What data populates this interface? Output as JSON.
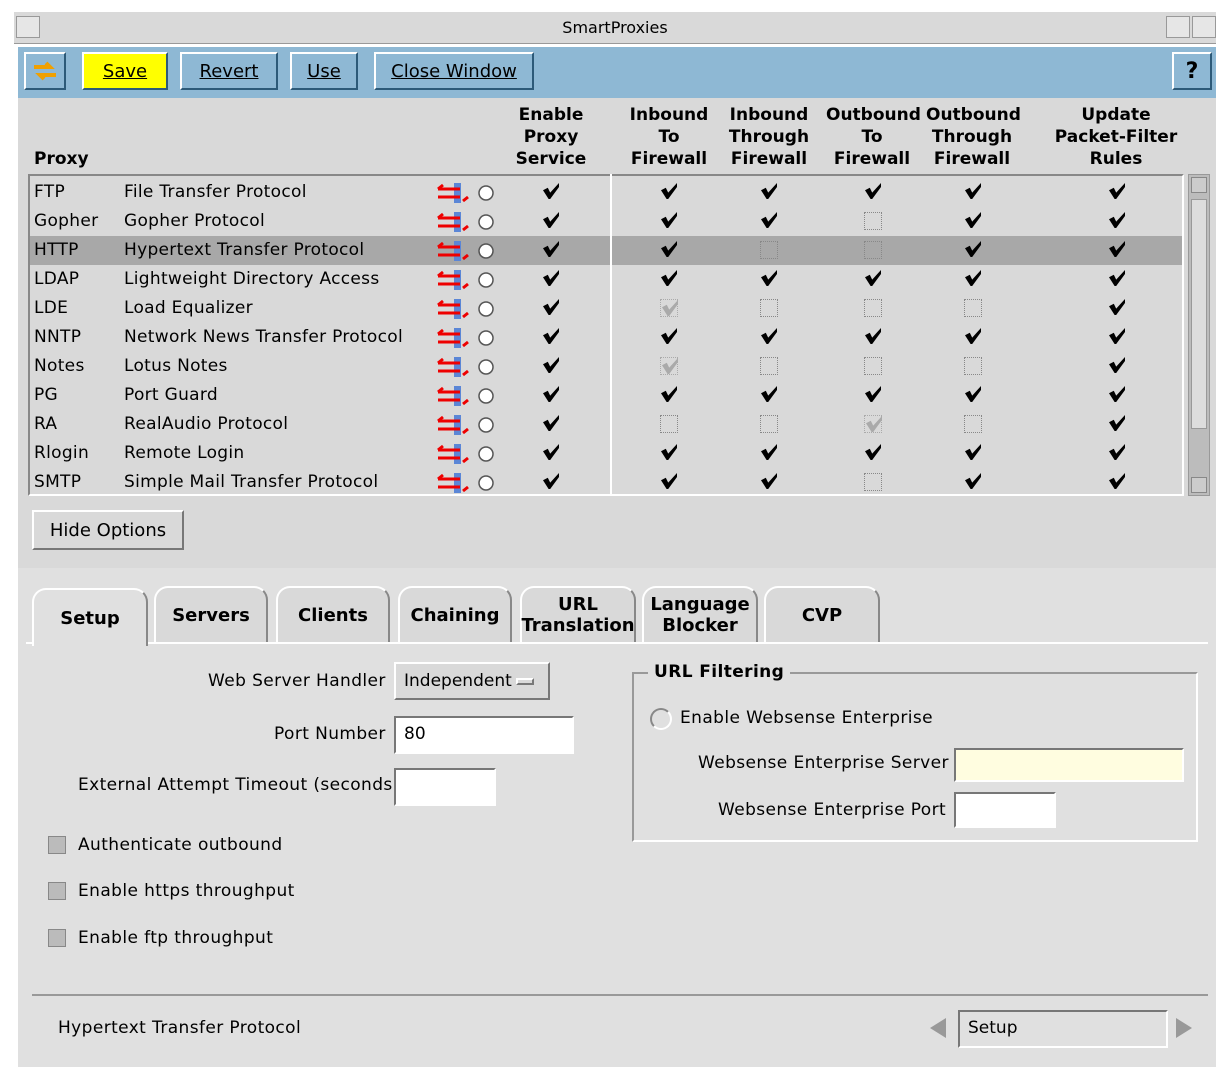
{
  "window": {
    "title": "SmartProxies"
  },
  "toolbar": {
    "save": "Save",
    "revert": "Revert",
    "use": "Use",
    "close": "Close Window",
    "help": "?"
  },
  "columns": {
    "proxy": "Proxy",
    "enable": "Enable Proxy Service",
    "in_to": "Inbound To Firewall",
    "in_through": "Inbound Through Firewall",
    "out_to": "Outbound To Firewall",
    "out_through": "Outbound Through Firewall",
    "update": "Update Packet-Filter Rules"
  },
  "rows": [
    {
      "code": "FTP",
      "name": "File Transfer Protocol",
      "checks": [
        "on",
        "on",
        "on",
        "on",
        "on",
        "on"
      ]
    },
    {
      "code": "Gopher",
      "name": "Gopher Protocol",
      "checks": [
        "on",
        "on",
        "on",
        "off",
        "on",
        "on"
      ]
    },
    {
      "code": "HTTP",
      "name": "Hypertext Transfer Protocol",
      "checks": [
        "on",
        "on",
        "off",
        "off",
        "on",
        "on"
      ],
      "selected": true
    },
    {
      "code": "LDAP",
      "name": "Lightweight Directory Access",
      "checks": [
        "on",
        "on",
        "on",
        "on",
        "on",
        "on"
      ]
    },
    {
      "code": "LDE",
      "name": "Load Equalizer",
      "checks": [
        "on",
        "dim",
        "off",
        "off",
        "off",
        "on"
      ]
    },
    {
      "code": "NNTP",
      "name": "Network News Transfer Protocol",
      "checks": [
        "on",
        "on",
        "on",
        "on",
        "on",
        "on"
      ]
    },
    {
      "code": "Notes",
      "name": "Lotus Notes",
      "checks": [
        "on",
        "dim",
        "off",
        "off",
        "off",
        "on"
      ]
    },
    {
      "code": "PG",
      "name": "Port Guard",
      "checks": [
        "on",
        "on",
        "on",
        "on",
        "on",
        "on"
      ]
    },
    {
      "code": "RA",
      "name": "RealAudio Protocol",
      "checks": [
        "on",
        "off",
        "off",
        "dim",
        "off",
        "on"
      ]
    },
    {
      "code": "Rlogin",
      "name": "Remote Login",
      "checks": [
        "on",
        "on",
        "on",
        "on",
        "on",
        "on"
      ]
    },
    {
      "code": "SMTP",
      "name": "Simple Mail Transfer Protocol",
      "checks": [
        "on",
        "on",
        "on",
        "off",
        "on",
        "on"
      ]
    }
  ],
  "hide_options": "Hide Options",
  "tabs": [
    "Setup",
    "Servers",
    "Clients",
    "Chaining",
    "URL Translation",
    "Language Blocker",
    "CVP"
  ],
  "setup": {
    "web_server_handler_label": "Web Server Handler",
    "web_server_handler_value": "Independent",
    "port_label": "Port Number",
    "port_value": "80",
    "timeout_label": "External Attempt Timeout (seconds)",
    "timeout_value": "",
    "auth_outbound": "Authenticate outbound",
    "https": "Enable https throughput",
    "ftp": "Enable ftp throughput"
  },
  "url_filtering": {
    "title": "URL Filtering",
    "enable": "Enable Websense Enterprise",
    "server_label": "Websense Enterprise Server",
    "server_value": "",
    "port_label": "Websense Enterprise Port",
    "port_value": ""
  },
  "status": {
    "text": "Hypertext Transfer Protocol",
    "nav_value": "Setup"
  }
}
